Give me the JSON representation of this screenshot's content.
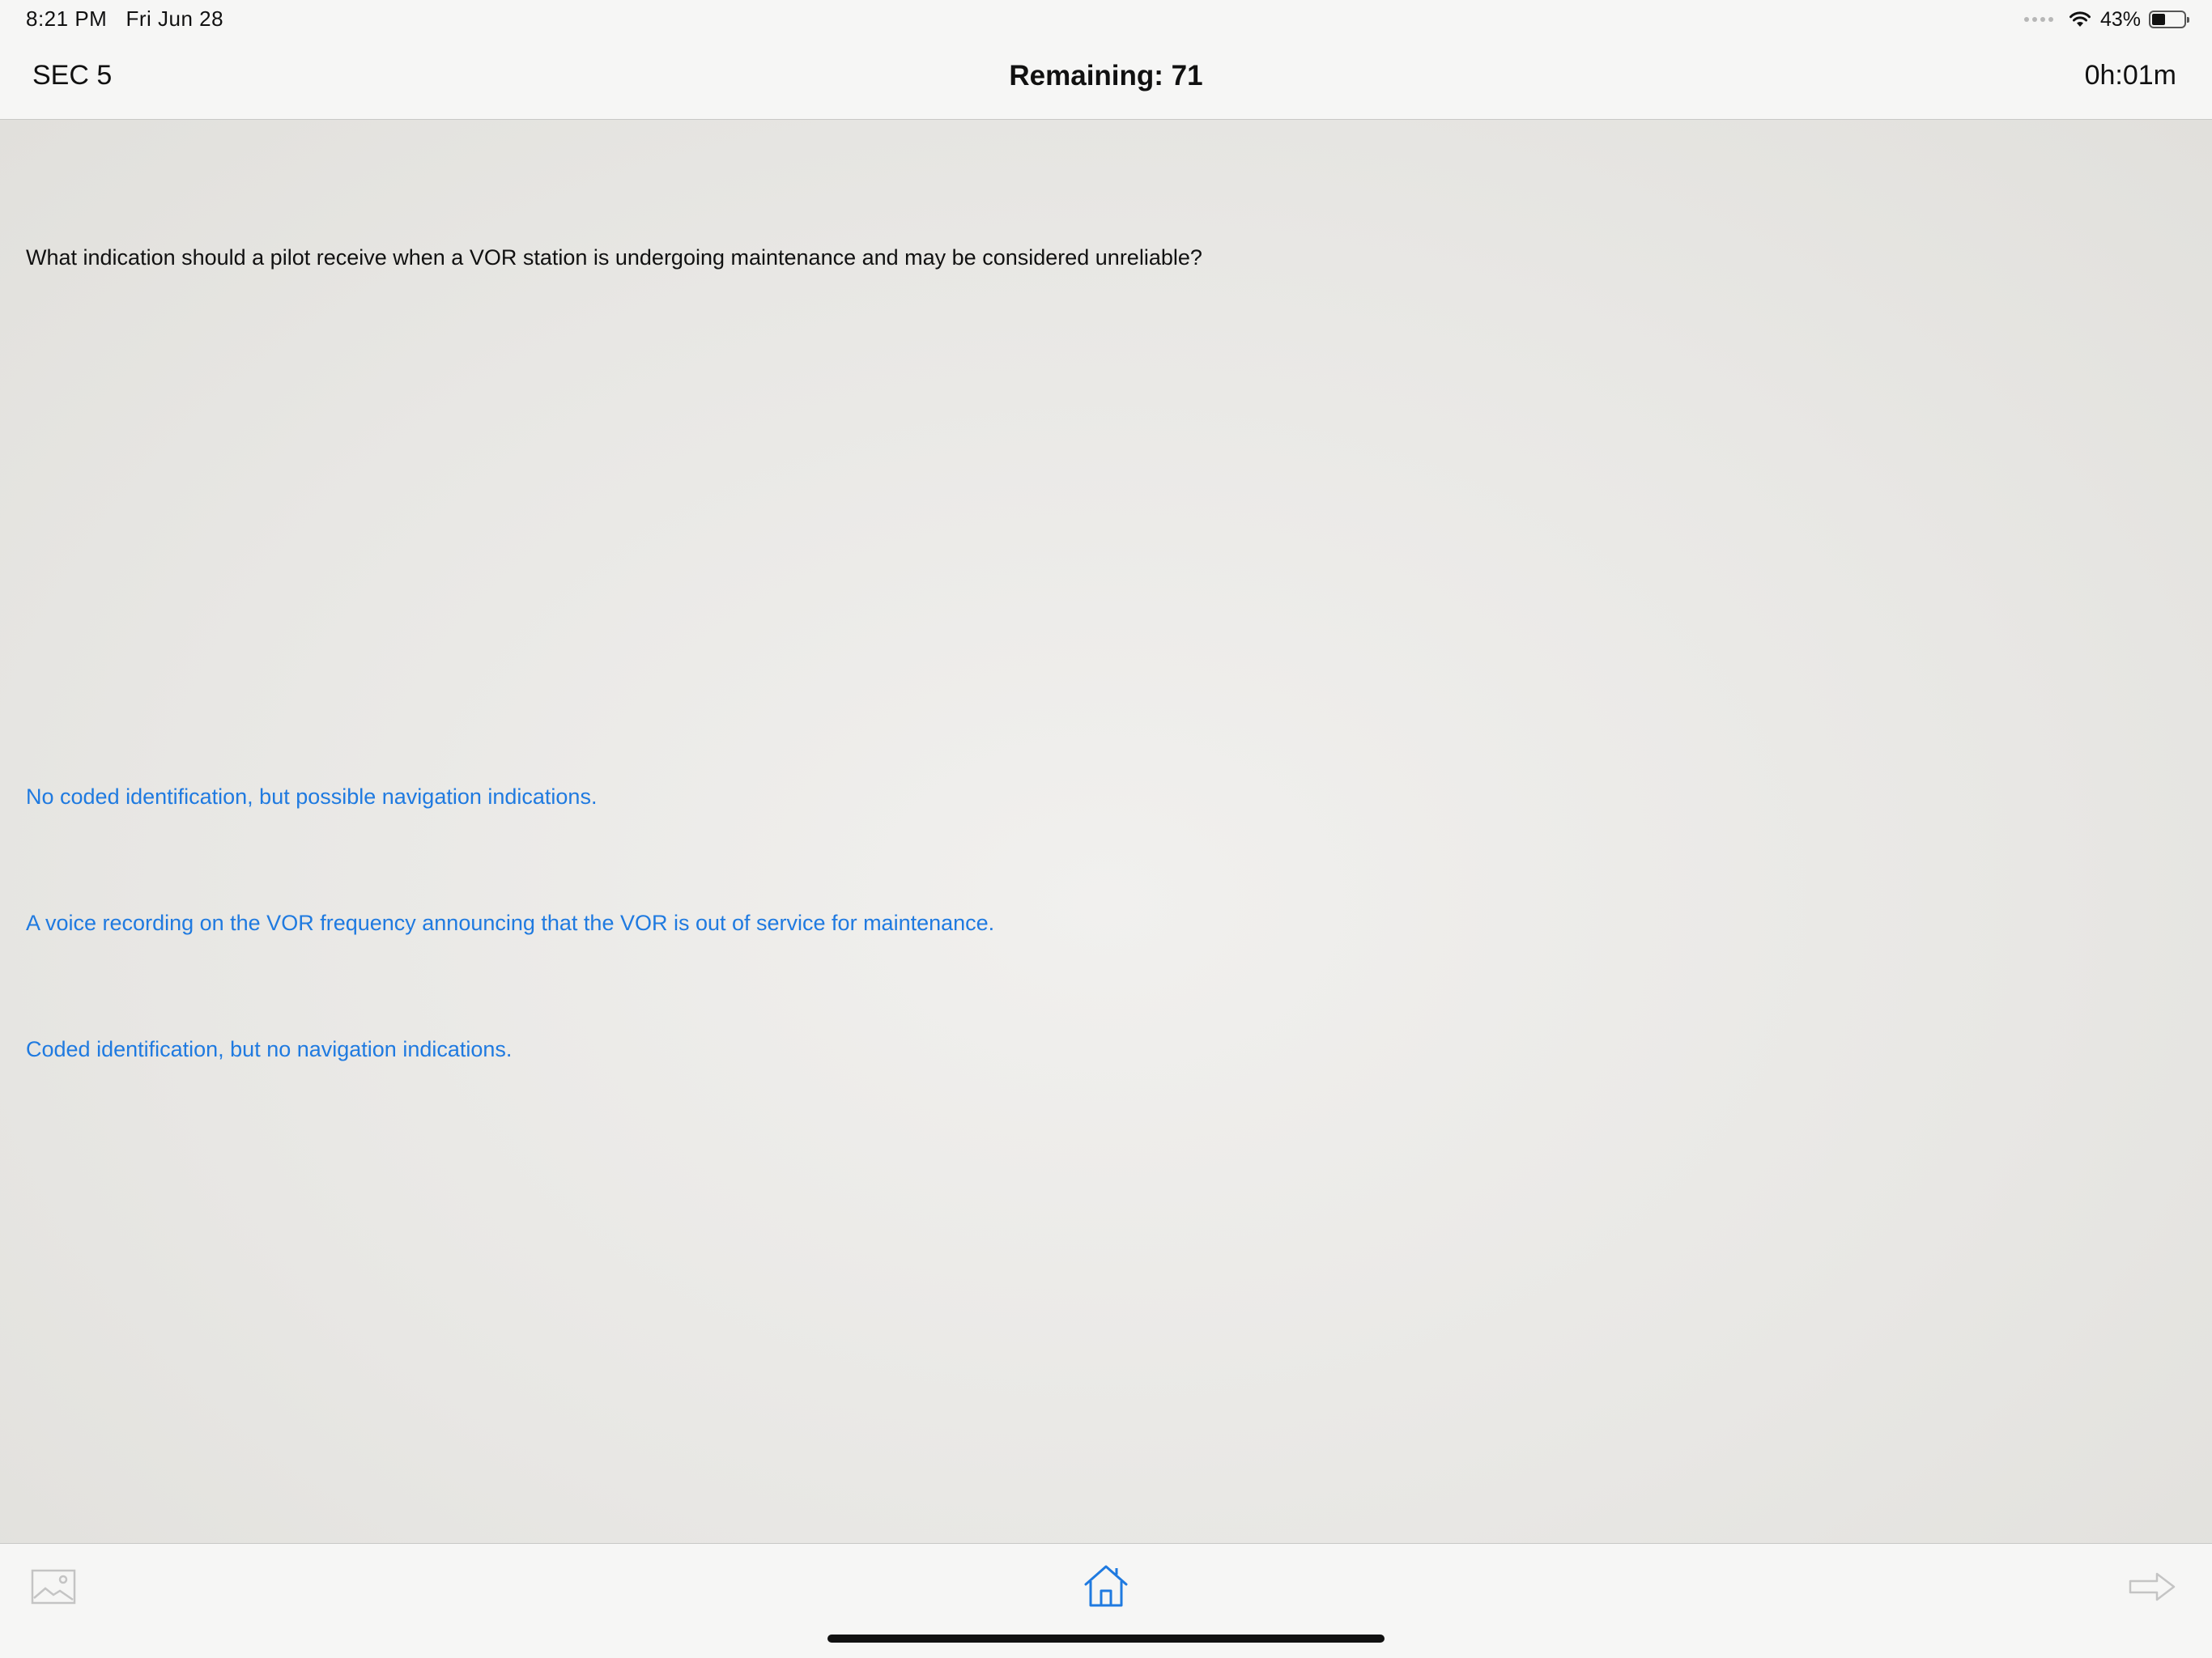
{
  "status_bar": {
    "time": "8:21 PM",
    "date": "Fri Jun 28",
    "battery_percent": "43%",
    "battery_level": 0.43,
    "wifi_icon": "wifi-icon",
    "battery_icon": "battery-icon"
  },
  "nav": {
    "section": "SEC 5",
    "remaining": "Remaining: 71",
    "timer": "0h:01m"
  },
  "question": {
    "text": "What indication should a pilot receive when a VOR station is undergoing maintenance and may be considered unreliable?"
  },
  "answers": [
    {
      "text": "No coded identification, but possible navigation indications."
    },
    {
      "text": "A voice recording on the VOR frequency announcing that the VOR is out of service for maintenance."
    },
    {
      "text": "Coded identification, but no navigation indications."
    }
  ],
  "toolbar": {
    "image_icon": "image-icon",
    "home_icon": "home-icon",
    "next_icon": "arrow-right-icon"
  },
  "colors": {
    "accent": "#1f7ae0",
    "text": "#111111",
    "bar_background": "#f6f6f5",
    "disabled_icon": "#c4c4c4"
  }
}
